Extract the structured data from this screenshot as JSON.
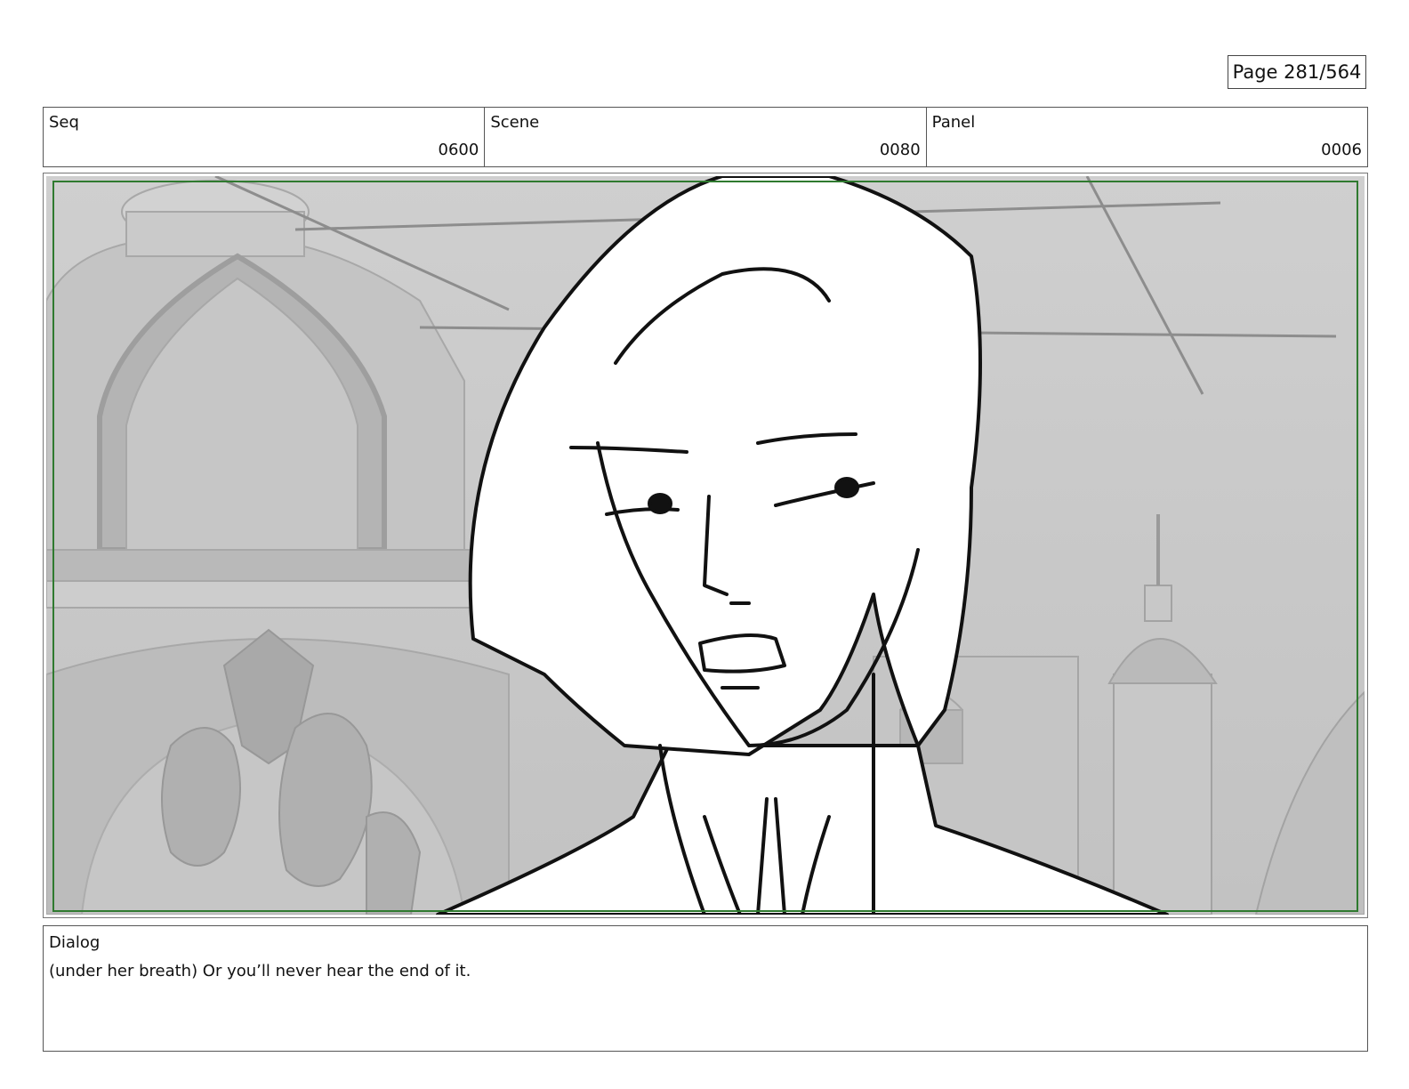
{
  "page": {
    "indicator": "Page 281/564"
  },
  "header": {
    "seq": {
      "label": "Seq",
      "value": "0600"
    },
    "scene": {
      "label": "Scene",
      "value": "0080"
    },
    "panel": {
      "label": "Panel",
      "value": "0006"
    }
  },
  "storyboard_panel": {
    "image_subject": "sketch-character-portrait",
    "safe_frame_color": "#2f7a2f",
    "background_tone": "#c9c9c9"
  },
  "dialog": {
    "label": "Dialog",
    "text": "(under her breath) Or you’ll never hear the end of it."
  }
}
